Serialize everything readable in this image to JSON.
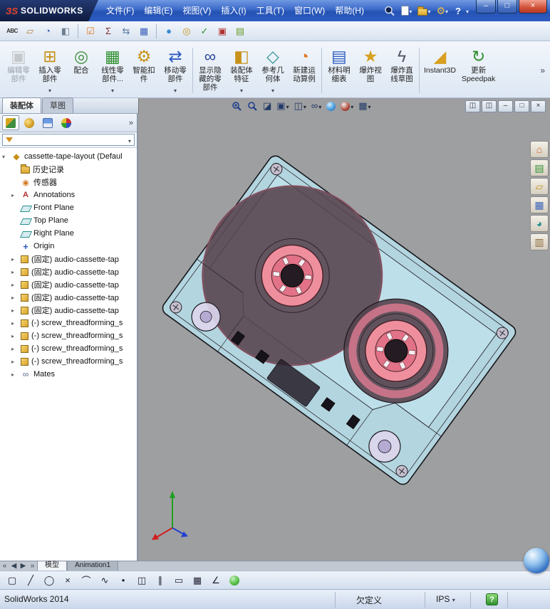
{
  "titlebar": {
    "logo_mark": "ЗS",
    "logo_text": "SOLIDWORKS",
    "menus": [
      {
        "label": "文件(F)"
      },
      {
        "label": "编辑(E)"
      },
      {
        "label": "视图(V)"
      },
      {
        "label": "插入(I)"
      },
      {
        "label": "工具(T)"
      },
      {
        "label": "窗口(W)"
      },
      {
        "label": "帮助(H)"
      }
    ],
    "help_label": "?",
    "controls": {
      "minimize": "–",
      "maximize": "□",
      "close": "×"
    }
  },
  "toolbar2": {
    "icons": [
      {
        "name": "spell-checker",
        "glyph": "ABC"
      },
      {
        "name": "measure",
        "glyph": "▱"
      },
      {
        "name": "mass-properties",
        "glyph": "◔"
      },
      {
        "name": "section-properties",
        "glyph": "◧"
      },
      {
        "name": "check-document",
        "glyph": "☑"
      },
      {
        "name": "equations",
        "glyph": "Σ"
      },
      {
        "name": "external-references",
        "glyph": "⇆"
      },
      {
        "name": "design-table",
        "glyph": "▦"
      },
      {
        "name": "edit-appearance",
        "glyph": "●"
      },
      {
        "name": "apply-material",
        "glyph": "◎"
      },
      {
        "name": "design-check",
        "glyph": "✓"
      },
      {
        "name": "record-video",
        "glyph": "▣"
      },
      {
        "name": "display-states",
        "glyph": "▤"
      }
    ]
  },
  "command_manager": {
    "tabs": [
      {
        "label": "装配体",
        "active": true
      },
      {
        "label": "草图",
        "active": false
      }
    ],
    "overflow": "»",
    "buttons": [
      {
        "label": "编辑零\n部件",
        "icon": "edit-component-icon",
        "glyph": "▣",
        "disabled": true
      },
      {
        "label": "插入零\n部件",
        "icon": "insert-components-icon",
        "glyph": "⊞",
        "dropdown": true
      },
      {
        "label": "配合",
        "icon": "mate-icon",
        "glyph": "◎"
      },
      {
        "label": "线性零\n部件...",
        "icon": "linear-component-pattern-icon",
        "glyph": "▦",
        "dropdown": true
      },
      {
        "label": "智能扣\n件",
        "icon": "smart-fasteners-icon",
        "glyph": "⚙"
      },
      {
        "label": "移动零\n部件",
        "icon": "move-component-icon",
        "glyph": "⇄",
        "dropdown": true
      },
      {
        "label": "显示隐\n藏的零\n部件",
        "icon": "show-hidden-components-icon",
        "glyph": "∞"
      },
      {
        "label": "装配体\n特征",
        "icon": "assembly-features-icon",
        "glyph": "◧",
        "dropdown": true
      },
      {
        "label": "参考几\n何体",
        "icon": "reference-geometry-icon",
        "glyph": "◇",
        "dropdown": true
      },
      {
        "label": "新建运\n动算例",
        "icon": "new-motion-study-icon",
        "glyph": "◔"
      },
      {
        "label": "材料明\n细表",
        "icon": "bill-of-materials-icon",
        "glyph": "▤"
      },
      {
        "label": "爆炸视\n图",
        "icon": "exploded-view-icon",
        "glyph": "★"
      },
      {
        "label": "爆炸直\n线草图",
        "icon": "explode-line-sketch-icon",
        "glyph": "ϟ"
      },
      {
        "label": "Instant3D",
        "icon": "instant3d-icon",
        "glyph": "◢"
      },
      {
        "label": "更新\nSpeedpak",
        "icon": "update-speedpak-icon",
        "glyph": "↻"
      }
    ]
  },
  "feature_panel": {
    "tabs": [
      "featuremanager-tree-icon",
      "propertymanager-icon",
      "configurationmanager-icon",
      "displaymanager-icon"
    ],
    "more": "»",
    "root": "cassette-tape-layout (Defaul",
    "items": [
      {
        "label": "历史记录",
        "icon": "history-folder-icon"
      },
      {
        "label": "传感器",
        "icon": "sensors-icon"
      },
      {
        "label": "Annotations",
        "icon": "annotations-icon"
      },
      {
        "label": "Front Plane",
        "icon": "plane-icon"
      },
      {
        "label": "Top Plane",
        "icon": "plane-icon"
      },
      {
        "label": "Right Plane",
        "icon": "plane-icon"
      },
      {
        "label": "Origin",
        "icon": "origin-icon"
      },
      {
        "label": "(固定) audio-cassette-tap",
        "icon": "part-icon"
      },
      {
        "label": "(固定) audio-cassette-tap",
        "icon": "part-icon"
      },
      {
        "label": "(固定) audio-cassette-tap",
        "icon": "part-icon"
      },
      {
        "label": "(固定) audio-cassette-tap",
        "icon": "part-icon"
      },
      {
        "label": "(固定) audio-cassette-tap",
        "icon": "part-icon"
      },
      {
        "label": "(-) screw_threadforming_s",
        "icon": "part-icon"
      },
      {
        "label": "(-) screw_threadforming_s",
        "icon": "part-icon"
      },
      {
        "label": "(-) screw_threadforming_s",
        "icon": "part-icon"
      },
      {
        "label": "(-) screw_threadforming_s",
        "icon": "part-icon"
      },
      {
        "label": "Mates",
        "icon": "mates-icon"
      }
    ]
  },
  "headsup": {
    "icons": [
      {
        "name": "zoom-to-fit"
      },
      {
        "name": "zoom-to-area"
      },
      {
        "name": "section-view",
        "glyph": "◪"
      },
      {
        "name": "view-orientation",
        "glyph": "▣",
        "dropdown": true
      },
      {
        "name": "display-style",
        "glyph": "◫",
        "dropdown": true
      },
      {
        "name": "hide-show-items",
        "glyph": "∞",
        "dropdown": true
      },
      {
        "name": "edit-appearance-ball"
      },
      {
        "name": "apply-scene-ball",
        "dropdown": true
      },
      {
        "name": "view-settings",
        "glyph": "▦",
        "dropdown": true
      }
    ]
  },
  "doc_controls": [
    {
      "name": "previous-window",
      "glyph": "◫"
    },
    {
      "name": "next-window",
      "glyph": "◫"
    },
    {
      "name": "minimize-document",
      "glyph": "–"
    },
    {
      "name": "restore-document",
      "glyph": "□"
    },
    {
      "name": "close-document",
      "glyph": "×"
    }
  ],
  "taskpane": [
    {
      "name": "solidworks-resources",
      "glyph": "⌂"
    },
    {
      "name": "design-library",
      "glyph": "▤"
    },
    {
      "name": "file-explorer",
      "glyph": "▱"
    },
    {
      "name": "view-palette",
      "glyph": "▦"
    },
    {
      "name": "appearances-scenes",
      "glyph": "◕"
    },
    {
      "name": "custom-properties",
      "glyph": "▥"
    }
  ],
  "bottom": {
    "arrows": [
      "«",
      "◀",
      "▶",
      "»"
    ],
    "tabs": [
      {
        "label": "模型",
        "active": true
      },
      {
        "label": "Animation1",
        "active": false
      }
    ]
  },
  "sketch_toolbar": {
    "icons": [
      {
        "name": "sketch",
        "glyph": "▢"
      },
      {
        "name": "line",
        "glyph": "╱"
      },
      {
        "name": "circle",
        "glyph": "◯"
      },
      {
        "name": "centerline",
        "glyph": "×"
      },
      {
        "name": "arc",
        "glyph": "⌒"
      },
      {
        "name": "spline",
        "glyph": "∿"
      },
      {
        "name": "point",
        "glyph": "•"
      },
      {
        "name": "mirror-entities",
        "glyph": "◫"
      },
      {
        "name": "offset-entities",
        "glyph": "∥"
      },
      {
        "name": "corner-rectangle",
        "glyph": "▭"
      },
      {
        "name": "linear-sketch-pattern",
        "glyph": "▦"
      },
      {
        "name": "smart-dimension",
        "glyph": "∠"
      },
      {
        "name": "material-ball"
      }
    ]
  },
  "statusbar": {
    "app_version": "SolidWorks 2014",
    "definition_status": "欠定义",
    "units": "IPS"
  },
  "model_colors": {
    "shell": "#b9e4f1",
    "reel": "#ef8f9d",
    "tape_spool": "#55424c",
    "roller": "#dcd5ec",
    "viewport_background": "#9e9fa1"
  }
}
